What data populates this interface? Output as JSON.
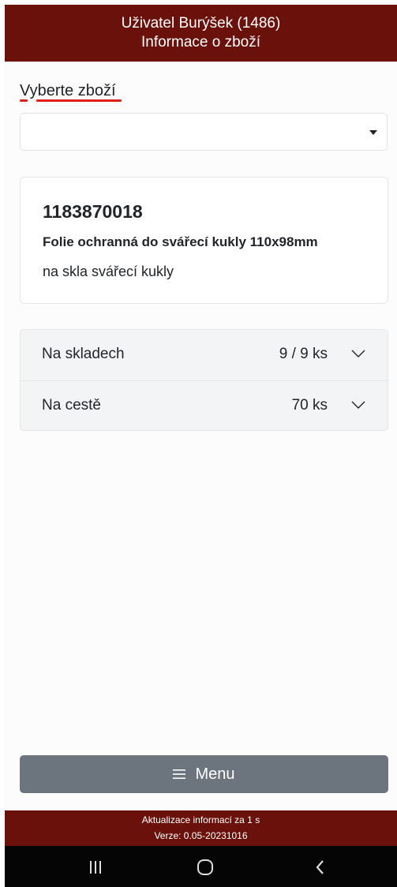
{
  "header": {
    "line1": "Uživatel Burýšek (1486)",
    "line2": "Informace o zboží"
  },
  "product_select": {
    "label": "Vyberte zboží",
    "value": ""
  },
  "product": {
    "code": "1183870018",
    "name": "Folie ochranná do svářecí kukly 110x98mm",
    "description": "na skla svářecí kukly"
  },
  "stock": [
    {
      "label": "Na skladech",
      "value": "9 / 9 ks"
    },
    {
      "label": "Na cestě",
      "value": "70 ks"
    }
  ],
  "menu": {
    "label": "Menu"
  },
  "footer": {
    "update_text": "Aktualizace informací za 1 s",
    "version": "Verze: 0.05-20231016"
  },
  "colors": {
    "brand": "#6b110c",
    "menu_button": "#6c757d",
    "spellcheck": "#e0201b"
  },
  "icons": {
    "select": "caret-down-icon",
    "accordion": "chevron-down-icon",
    "menu": "hamburger-icon",
    "nav": [
      "recents-icon",
      "home-icon",
      "back-icon"
    ]
  }
}
